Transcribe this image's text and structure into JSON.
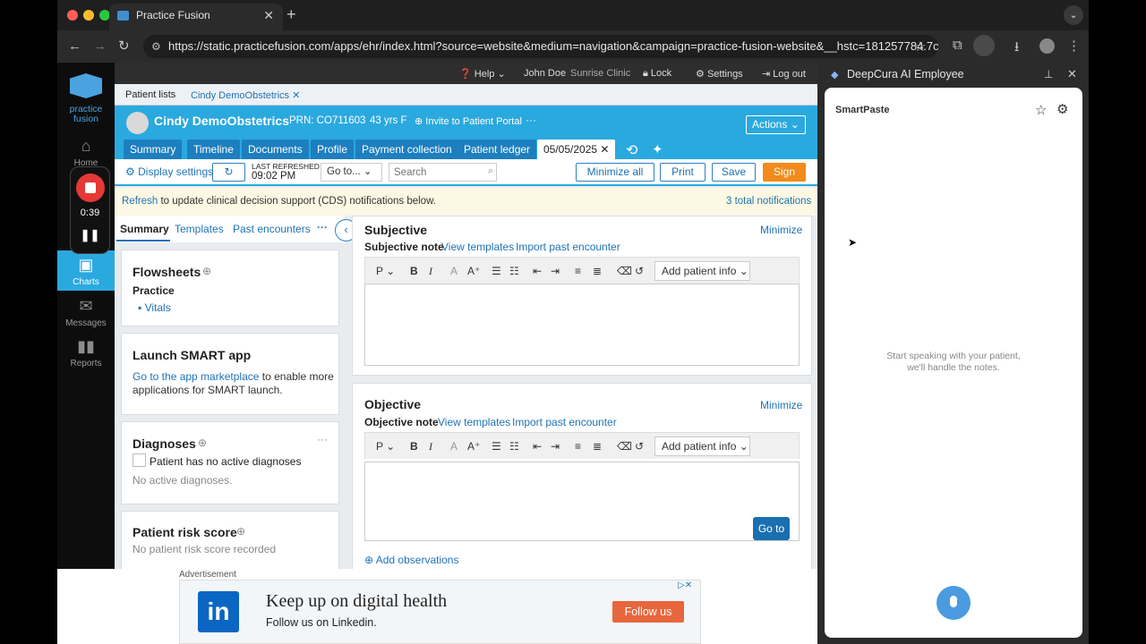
{
  "browser": {
    "tab_title": "Practice Fusion",
    "url": "https://static.practicefusion.com/apps/ehr/index.html?source=website&medium=navigation&campaign=practice-fusion-website&__hstc=181257784.7cf5f..."
  },
  "leftnav": {
    "logo_line1": "practice",
    "logo_line2": "fusion",
    "items": [
      {
        "label": "Home",
        "icon": "home-icon"
      },
      {
        "label": "Charts",
        "icon": "clipboard-icon"
      },
      {
        "label": "Messages",
        "icon": "envelope-icon"
      },
      {
        "label": "Reports",
        "icon": "bar-chart-icon"
      }
    ],
    "recording_time": "0:39"
  },
  "topnav": {
    "help": "Help",
    "user": "John Doe",
    "clinic": "Sunrise Clinic",
    "lock": "Lock",
    "settings": "Settings",
    "logout": "Log out"
  },
  "patient_tabs": {
    "lists": "Patient lists",
    "current": "Cindy DemoObstetrics"
  },
  "patient": {
    "name": "Cindy DemoObstetrics",
    "prn": "PRN: CO711603",
    "age": "43 yrs F",
    "invite": "Invite to Patient Portal",
    "more": "···",
    "actions": "Actions"
  },
  "chart_tabs": [
    "Summary",
    "Timeline",
    "Documents",
    "Profile",
    "Payment collection",
    "Patient ledger"
  ],
  "encounter_tab": "05/05/2025",
  "toolbar": {
    "display_settings": "Display settings",
    "last_refreshed_label": "LAST REFRESHED",
    "last_refreshed_time": "09:02 PM",
    "goto": "Go to...",
    "search_placeholder": "Search",
    "minimize_all": "Minimize all",
    "print": "Print",
    "save": "Save",
    "sign": "Sign"
  },
  "cds": {
    "refresh": "Refresh",
    "message": " to update clinical decision support (CDS) notifications below.",
    "total": "3 total notifications"
  },
  "left_panel": {
    "tabs": [
      "Summary",
      "Templates",
      "Past encounters"
    ],
    "flowsheets": {
      "title": "Flowsheets",
      "sub": "Practice",
      "item": "Vitals"
    },
    "smart": {
      "title": "Launch SMART app",
      "link": "Go to the app marketplace",
      "text1": " to enable more",
      "text2": "applications for SMART launch."
    },
    "diagnoses": {
      "title": "Diagnoses",
      "checkbox": "Patient has no active diagnoses",
      "empty": "No active diagnoses."
    },
    "risk": {
      "title": "Patient risk score",
      "empty": "No patient risk score recorded"
    }
  },
  "subjective": {
    "title": "Subjective",
    "minimize": "Minimize",
    "note": "Subjective note",
    "view_templates": "View templates",
    "import": "Import past encounter",
    "format": "P",
    "add_info": "Add patient info"
  },
  "objective": {
    "title": "Objective",
    "minimize": "Minimize",
    "note": "Objective note",
    "view_templates": "View templates",
    "import": "Import past encounter",
    "format": "P",
    "add_info": "Add patient info",
    "goto_button": "Go to",
    "add_observations": "Add observations"
  },
  "ad": {
    "label": "Advertisement",
    "headline": "Keep up on digital health",
    "sub": "Follow us on Linkedin.",
    "cta": "Follow us"
  },
  "side_panel": {
    "title": "DeepCura AI Employee",
    "section": "SmartPaste",
    "hint1": "Start speaking with your patient,",
    "hint2": "we'll handle the notes."
  }
}
